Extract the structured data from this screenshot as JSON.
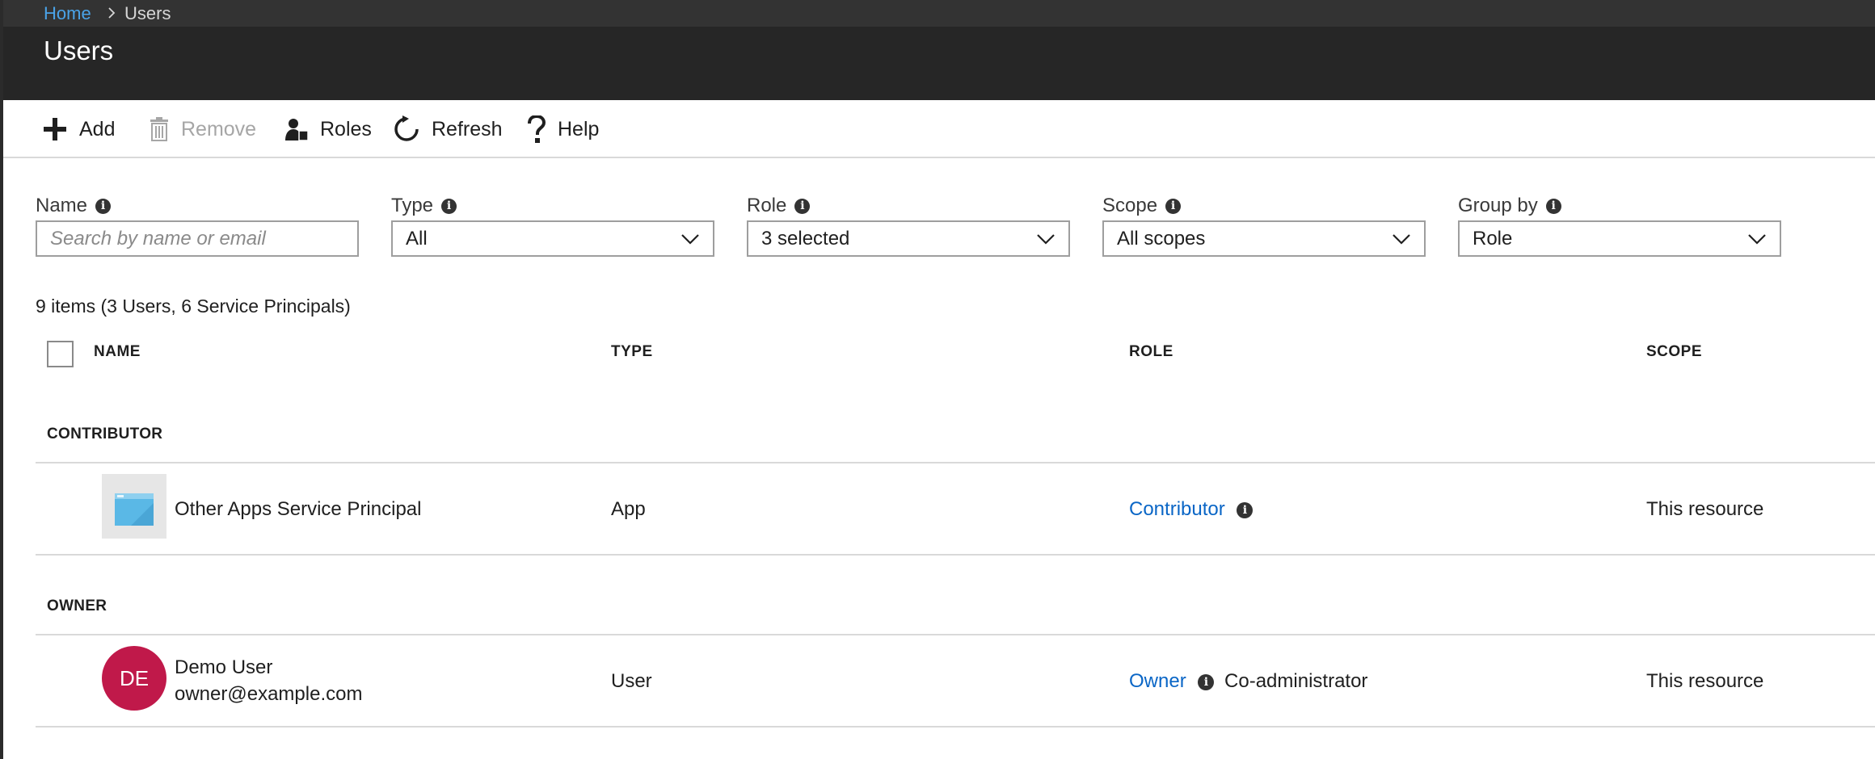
{
  "breadcrumb": {
    "home": "Home",
    "current": "Users"
  },
  "page": {
    "title": "Users"
  },
  "toolbar": {
    "add": "Add",
    "remove": "Remove",
    "roles": "Roles",
    "refresh": "Refresh",
    "help": "Help"
  },
  "filters": {
    "name": {
      "label": "Name",
      "placeholder": "Search by name or email"
    },
    "type": {
      "label": "Type",
      "value": "All"
    },
    "role": {
      "label": "Role",
      "value": "3 selected"
    },
    "scope": {
      "label": "Scope",
      "value": "All scopes"
    },
    "group_by": {
      "label": "Group by",
      "value": "Role"
    }
  },
  "summary": "9 items (3 Users, 6 Service Principals)",
  "table": {
    "columns": {
      "name": "NAME",
      "type": "TYPE",
      "role": "ROLE",
      "scope": "SCOPE"
    },
    "groups": [
      {
        "heading": "CONTRIBUTOR",
        "rows": [
          {
            "name": "Other Apps Service Principal",
            "type": "App",
            "role": "Contributor",
            "role_note": "",
            "scope": "This resource"
          }
        ]
      },
      {
        "heading": "OWNER",
        "rows": [
          {
            "name": "Demo User",
            "email": "owner@example.com",
            "initials": "DE",
            "type": "User",
            "role": "Owner",
            "role_note": "Co-administrator",
            "scope": "This resource"
          }
        ]
      }
    ]
  },
  "icons": {
    "info": "info-icon",
    "info_glyph": "i",
    "add": "plus-icon",
    "remove": "trash-icon",
    "roles": "roles-icon",
    "refresh": "refresh-icon",
    "help": "help-icon",
    "select": "chevron-down-icon"
  },
  "colors": {
    "header_bg": "#262626",
    "link": "#0a66c6",
    "avatar": "#c0194a",
    "breadcrumb_link": "#4aa3e8"
  }
}
